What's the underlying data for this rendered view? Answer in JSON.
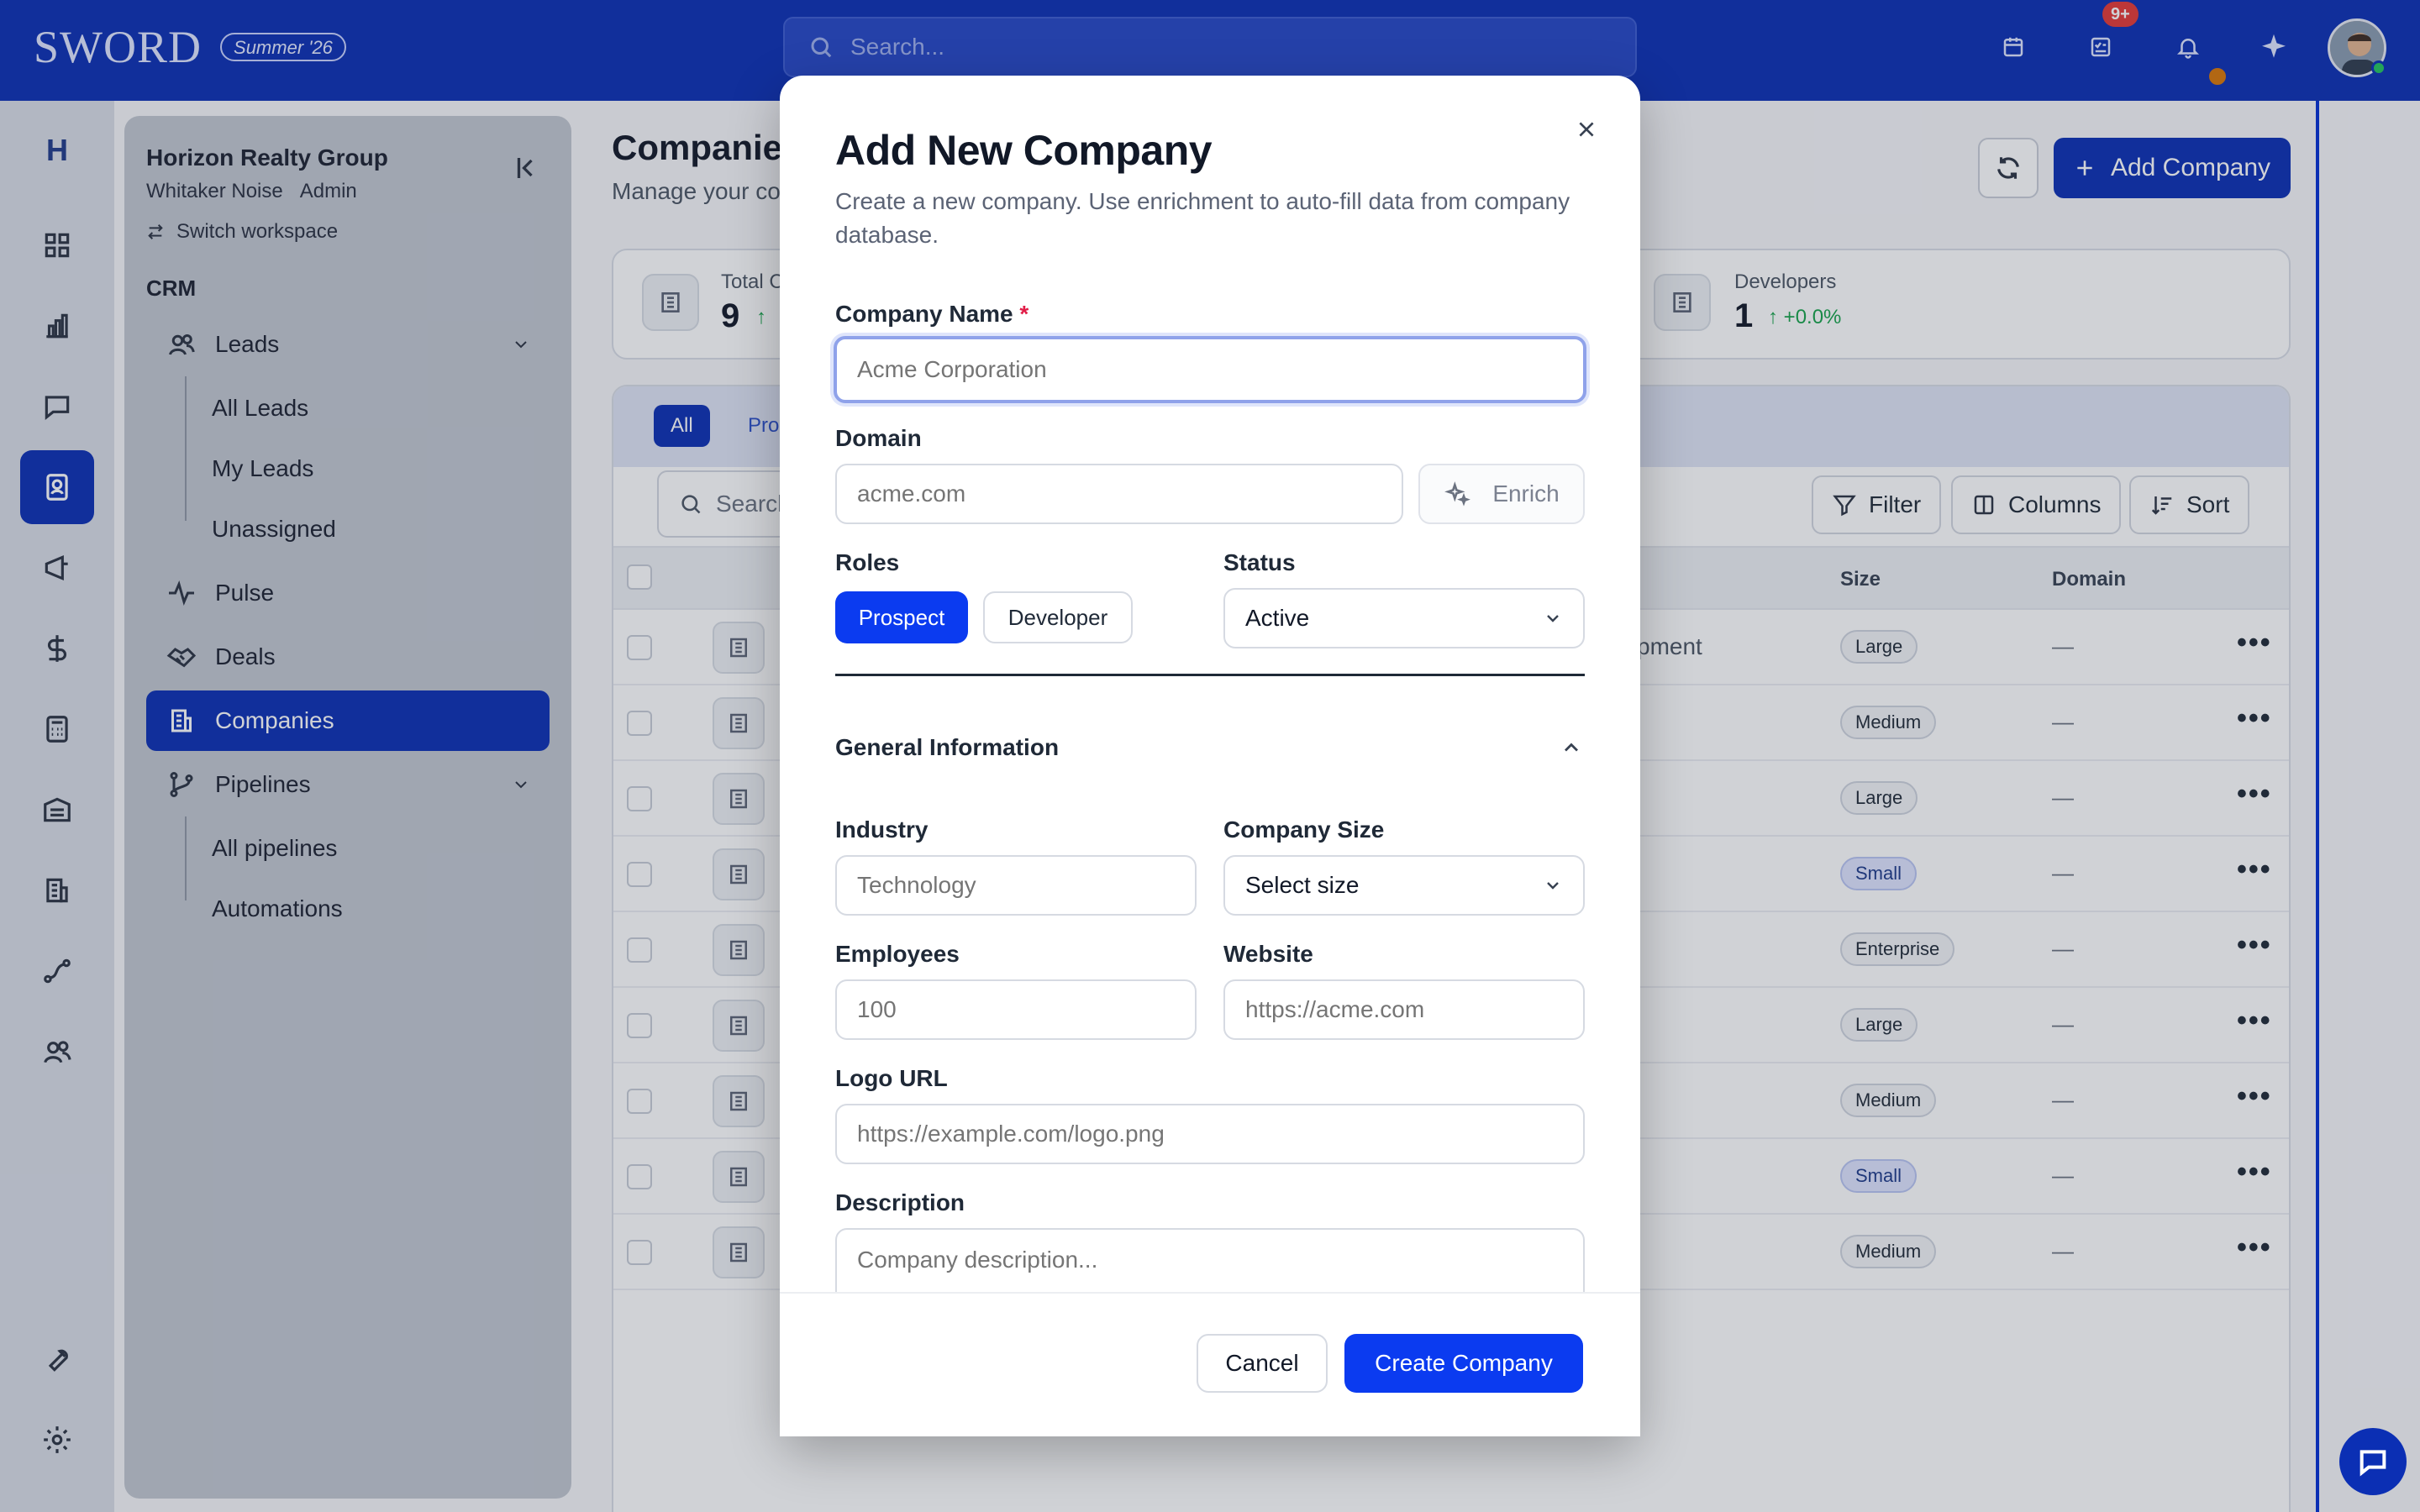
{
  "app": {
    "brand": "SWORD",
    "season_badge": "Summer '26",
    "search_placeholder": "Search...",
    "tasks_badge": "9+",
    "colors": {
      "primary": "#0b2fb4",
      "accent": "#0b3bf0",
      "success": "#16a34a",
      "danger": "#e53935"
    }
  },
  "rail": {
    "logo": "H",
    "icons": [
      "dashboard-icon",
      "analytics-icon",
      "messages-icon",
      "contacts-icon",
      "campaigns-icon",
      "dollar-icon",
      "calculator-icon",
      "warehouse-icon",
      "building-icon",
      "route-icon",
      "team-icon",
      "wrench-icon",
      "settings-icon"
    ]
  },
  "sidebar": {
    "workspace": "Horizon Realty Group",
    "user": "Whitaker Noise",
    "role": "Admin",
    "switch_label": "Switch workspace",
    "section": "CRM",
    "leads": "Leads",
    "leads_children": [
      "All Leads",
      "My Leads",
      "Unassigned"
    ],
    "pulse": "Pulse",
    "deals": "Deals",
    "companies": "Companies",
    "pipelines": "Pipelines",
    "pipelines_children": [
      "All pipelines",
      "Automations"
    ]
  },
  "page": {
    "title": "Companies",
    "subtitle": "Manage your co",
    "add_button": "Add Company",
    "stats": [
      {
        "label": "Total C",
        "value": "9",
        "delta": ""
      },
      {
        "label": "Developers",
        "value": "1",
        "delta": "+0.0%"
      }
    ],
    "tabs": [
      "All",
      "Prosp"
    ],
    "table_search": "Search",
    "tools": {
      "filter": "Filter",
      "columns": "Columns",
      "sort": "Sort"
    },
    "columns": {
      "size": "Size",
      "domain": "Domain"
    },
    "row_fragment": "pment",
    "rows": [
      {
        "size": "Large",
        "domain": "—"
      },
      {
        "size": "Medium",
        "domain": "—"
      },
      {
        "size": "Large",
        "domain": "—"
      },
      {
        "size": "Small",
        "domain": "—"
      },
      {
        "size": "Enterprise",
        "domain": "—"
      },
      {
        "size": "Large",
        "domain": "—"
      },
      {
        "size": "Medium",
        "domain": "—"
      },
      {
        "size": "Small",
        "domain": "—"
      },
      {
        "size": "Medium",
        "domain": "—"
      }
    ],
    "row_action": "•••"
  },
  "modal": {
    "title": "Add New Company",
    "description": "Create a new company. Use enrichment to auto-fill data from company database.",
    "company_name": {
      "label": "Company Name",
      "required": "*",
      "placeholder": "Acme Corporation"
    },
    "domain": {
      "label": "Domain",
      "placeholder": "acme.com",
      "enrich": "Enrich"
    },
    "roles": {
      "label": "Roles",
      "options": [
        "Prospect",
        "Developer"
      ],
      "selected": "Prospect"
    },
    "status": {
      "label": "Status",
      "value": "Active"
    },
    "general_section": "General Information",
    "industry": {
      "label": "Industry",
      "placeholder": "Technology"
    },
    "company_size": {
      "label": "Company Size",
      "value": "Select size"
    },
    "employees": {
      "label": "Employees",
      "placeholder": "100"
    },
    "website": {
      "label": "Website",
      "placeholder": "https://acme.com"
    },
    "logo_url": {
      "label": "Logo URL",
      "placeholder": "https://example.com/logo.png"
    },
    "description_field": {
      "label": "Description",
      "placeholder": "Company description..."
    },
    "cancel": "Cancel",
    "create": "Create Company"
  }
}
